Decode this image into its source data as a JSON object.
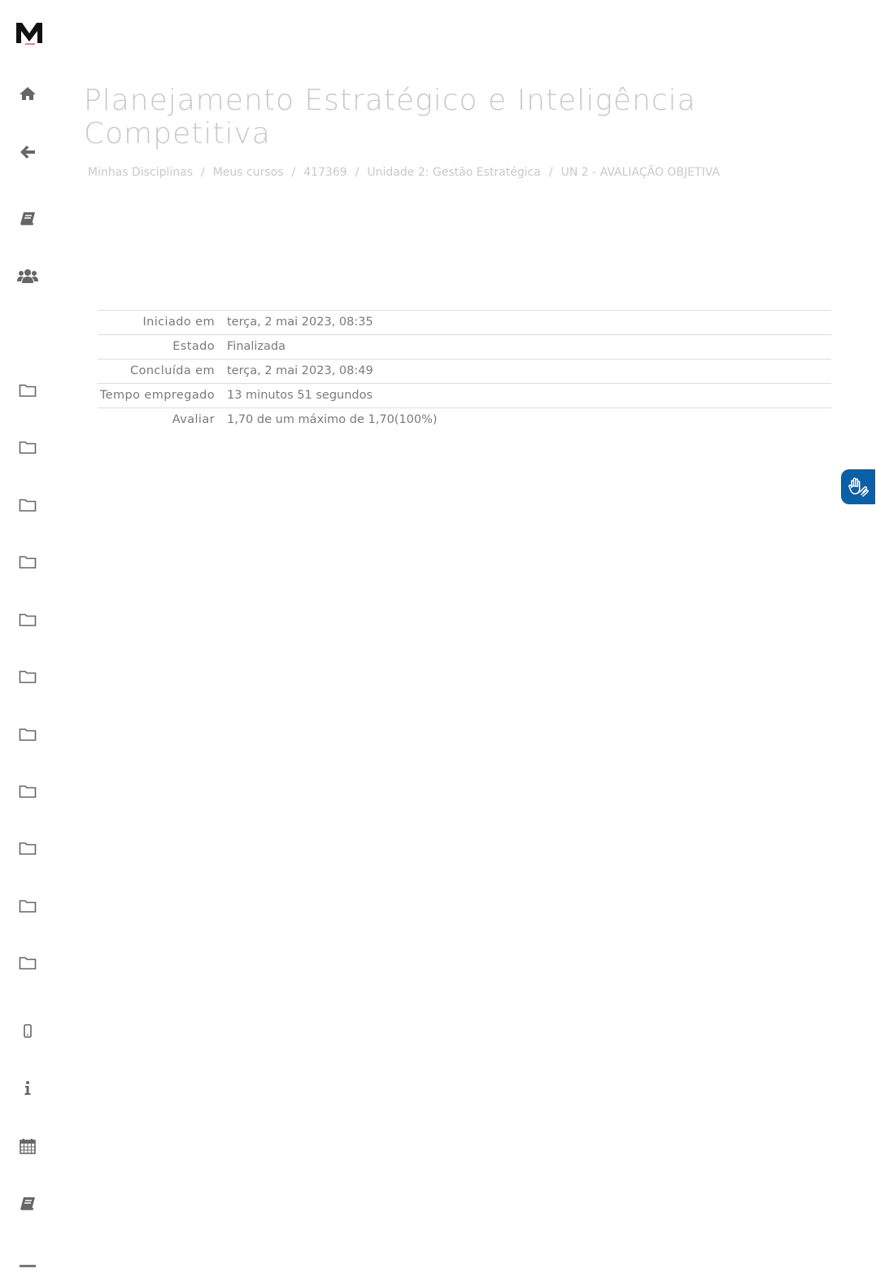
{
  "brand": {
    "logo_letter": "M",
    "logo_color": "#111111",
    "accent": "#c0392b"
  },
  "sidebar": {
    "icons": [
      "home-icon",
      "back-arrow-icon",
      "book-icon",
      "users-icon",
      "folder-icon",
      "folder-icon",
      "folder-icon",
      "folder-icon",
      "folder-icon",
      "folder-icon",
      "folder-icon",
      "folder-icon",
      "folder-icon",
      "folder-icon",
      "folder-icon",
      "mobile-icon",
      "info-icon",
      "calendar-icon",
      "book-icon"
    ]
  },
  "header": {
    "title": "Planejamento Estratégico e Inteligência Competitiva"
  },
  "breadcrumb": [
    "Minhas Disciplinas",
    "Meus cursos",
    "417369",
    "Unidade 2: Gestão Estratégica",
    "UN 2 - AVALIAÇÃO OBJETIVA"
  ],
  "summary": {
    "rows": [
      {
        "label": "Iniciado em",
        "value": "terça, 2 mai 2023, 08:35"
      },
      {
        "label": "Estado",
        "value": "Finalizada"
      },
      {
        "label": "Concluída em",
        "value": "terça, 2 mai 2023, 08:49"
      },
      {
        "label": "Tempo empregado",
        "value": "13 minutos 51 segundos"
      },
      {
        "label": "Avaliar",
        "value": "1,70 de um máximo de 1,70(100%)"
      }
    ]
  },
  "accessibility": {
    "icon": "sign-language-icon",
    "color": "#0b5fa5"
  }
}
